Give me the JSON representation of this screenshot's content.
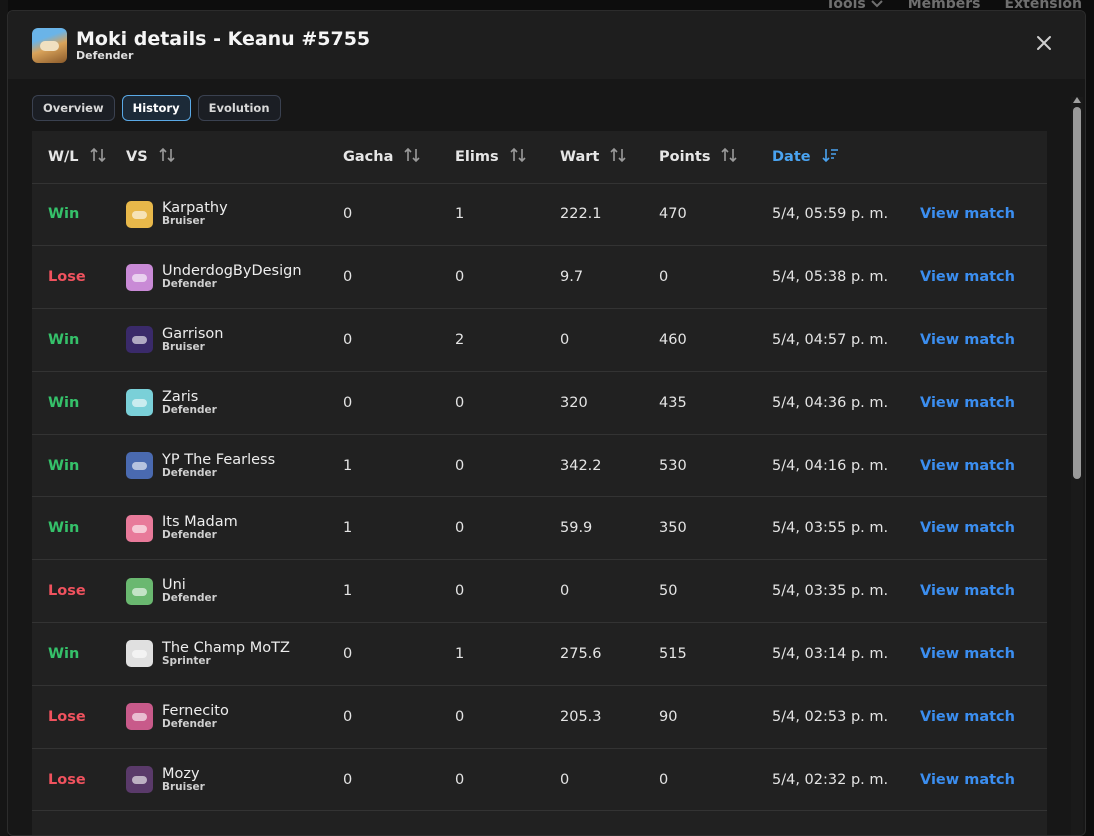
{
  "background_nav": [
    "Tools",
    "Members",
    "Extension"
  ],
  "modal": {
    "title": "Moki details - Keanu #5755",
    "subtitle": "Defender",
    "tabs": [
      {
        "label": "Overview",
        "active": false
      },
      {
        "label": "History",
        "active": true
      },
      {
        "label": "Evolution",
        "active": false
      }
    ]
  },
  "table": {
    "headers": {
      "wl": "W/L",
      "vs": "VS",
      "gacha": "Gacha",
      "elims": "Elims",
      "wart": "Wart",
      "points": "Points",
      "date": "Date"
    },
    "rows": [
      {
        "result": "Win",
        "name": "Karpathy",
        "class": "Bruiser",
        "gacha": "0",
        "elims": "1",
        "wart": "222.1",
        "points": "470",
        "date": "5/4, 05:59 p. m.",
        "action": "View match",
        "avatar_color": "#e8b84a"
      },
      {
        "result": "Lose",
        "name": "UnderdogByDesign",
        "class": "Defender",
        "gacha": "0",
        "elims": "0",
        "wart": "9.7",
        "points": "0",
        "date": "5/4, 05:38 p. m.",
        "action": "View match",
        "avatar_color": "#c98ad6"
      },
      {
        "result": "Win",
        "name": "Garrison",
        "class": "Bruiser",
        "gacha": "0",
        "elims": "2",
        "wart": "0",
        "points": "460",
        "date": "5/4, 04:57 p. m.",
        "action": "View match",
        "avatar_color": "#3a2a6a"
      },
      {
        "result": "Win",
        "name": "Zaris",
        "class": "Defender",
        "gacha": "0",
        "elims": "0",
        "wart": "320",
        "points": "435",
        "date": "5/4, 04:36 p. m.",
        "action": "View match",
        "avatar_color": "#7ad0d8"
      },
      {
        "result": "Win",
        "name": "YP The Fearless",
        "class": "Defender",
        "gacha": "1",
        "elims": "0",
        "wart": "342.2",
        "points": "530",
        "date": "5/4, 04:16 p. m.",
        "action": "View match",
        "avatar_color": "#4a6ab0"
      },
      {
        "result": "Win",
        "name": "Its Madam",
        "class": "Defender",
        "gacha": "1",
        "elims": "0",
        "wart": "59.9",
        "points": "350",
        "date": "5/4, 03:55 p. m.",
        "action": "View match",
        "avatar_color": "#e87a9a"
      },
      {
        "result": "Lose",
        "name": "Uni",
        "class": "Defender",
        "gacha": "1",
        "elims": "0",
        "wart": "0",
        "points": "50",
        "date": "5/4, 03:35 p. m.",
        "action": "View match",
        "avatar_color": "#6ab870"
      },
      {
        "result": "Win",
        "name": "The Champ MoTZ",
        "class": "Sprinter",
        "gacha": "0",
        "elims": "1",
        "wart": "275.6",
        "points": "515",
        "date": "5/4, 03:14 p. m.",
        "action": "View match",
        "avatar_color": "#e0e0e0"
      },
      {
        "result": "Lose",
        "name": "Fernecito",
        "class": "Defender",
        "gacha": "0",
        "elims": "0",
        "wart": "205.3",
        "points": "90",
        "date": "5/4, 02:53 p. m.",
        "action": "View match",
        "avatar_color": "#c85a8a"
      },
      {
        "result": "Lose",
        "name": "Mozy",
        "class": "Bruiser",
        "gacha": "0",
        "elims": "0",
        "wart": "0",
        "points": "0",
        "date": "5/4, 02:32 p. m.",
        "action": "View match",
        "avatar_color": "#5a3a6a"
      }
    ]
  },
  "colors": {
    "win": "#35c16a",
    "lose": "#f0525e",
    "link": "#3b8ef0",
    "active_sort": "#4aa3f0"
  },
  "icons": [
    "close-icon",
    "sort-icon",
    "sort-desc-icon",
    "chevron-down-icon"
  ]
}
